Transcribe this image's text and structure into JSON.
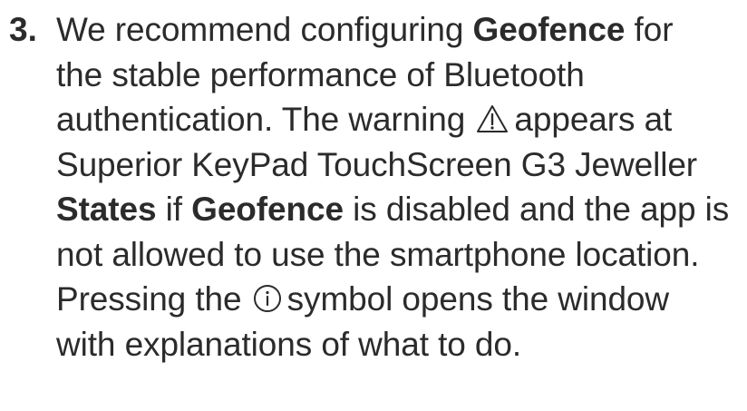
{
  "step": {
    "number": "3.",
    "lines": {
      "l1_a": "We recommend configuring ",
      "l1_b": "Geofence",
      "l1_c": " for",
      "l2": "the stable performance of Bluetooth",
      "l3_a": "authentication. The warning ",
      "l3_b": "appears at",
      "l4": "Superior KeyPad TouchScreen G3 Jeweller",
      "l5_a": "States",
      "l5_b": " if ",
      "l5_c": "Geofence",
      "l5_d": " is disabled and the app is",
      "l6": "not allowed to use the smartphone location.",
      "l7_a": "Pressing the ",
      "l7_b": "symbol opens the window",
      "l8": "with explanations of what to do."
    },
    "icons": {
      "warning": "warning-triangle-icon",
      "info": "info-circle-icon"
    }
  }
}
